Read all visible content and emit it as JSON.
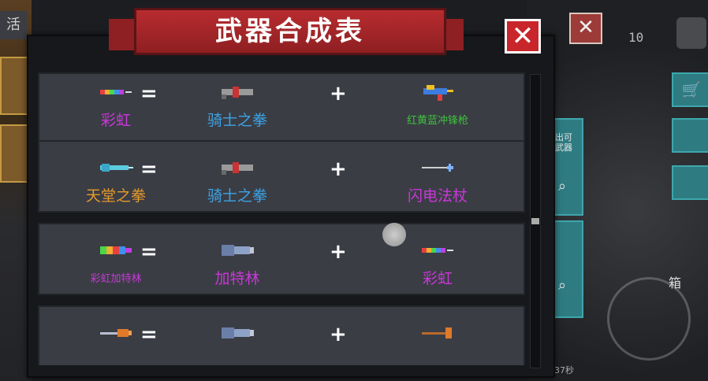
{
  "window": {
    "title": "武器合成表",
    "close_glyph": "✕",
    "bg_close_glyph": "✕"
  },
  "background": {
    "left_tab_label": "活",
    "kill_count": "10",
    "side_label": "出可武器",
    "right_partial": "箱",
    "timer": "37秒"
  },
  "colors": {
    "equals": "#ffffff",
    "rainbow": "#c838d8",
    "blue": "#3ba4e6",
    "orange": "#e79a2a",
    "green": "#3ec23c",
    "ribbon": "#b82c2f"
  },
  "recipes": [
    {
      "result": {
        "name": "彩虹",
        "color": "#c838d8",
        "icon": "rainbow-gun-icon"
      },
      "ingredient_a": {
        "name": "骑士之拳",
        "color": "#3ba4e6",
        "icon": "knight-fist-gun-icon"
      },
      "ingredient_b": {
        "name": "红黄蓝冲锋枪",
        "color": "#3ec23c",
        "icon": "rgb-smg-icon"
      },
      "equals": "=",
      "plus": "+"
    },
    {
      "result": {
        "name": "天堂之拳",
        "color": "#e79a2a",
        "icon": "heaven-fist-gun-icon"
      },
      "ingredient_a": {
        "name": "骑士之拳",
        "color": "#3ba4e6",
        "icon": "knight-fist-gun-icon"
      },
      "ingredient_b": {
        "name": "闪电法杖",
        "color": "#c838d8",
        "icon": "lightning-staff-icon"
      },
      "equals": "=",
      "plus": "+"
    },
    {
      "result": {
        "name": "彩虹加特林",
        "color": "#c838d8",
        "icon": "rainbow-gatling-icon"
      },
      "ingredient_a": {
        "name": "加特林",
        "color": "#c838d8",
        "icon": "gatling-icon"
      },
      "ingredient_b": {
        "name": "彩虹",
        "color": "#c838d8",
        "icon": "rainbow-gun-icon"
      },
      "equals": "=",
      "plus": "+"
    },
    {
      "result": {
        "name": "",
        "color": "#c838d8",
        "icon": "cannon-staff-icon"
      },
      "ingredient_a": {
        "name": "",
        "color": "#c838d8",
        "icon": "gatling-icon"
      },
      "ingredient_b": {
        "name": "",
        "color": "#c838d8",
        "icon": "plunger-staff-icon"
      },
      "equals": "=",
      "plus": "+"
    }
  ]
}
